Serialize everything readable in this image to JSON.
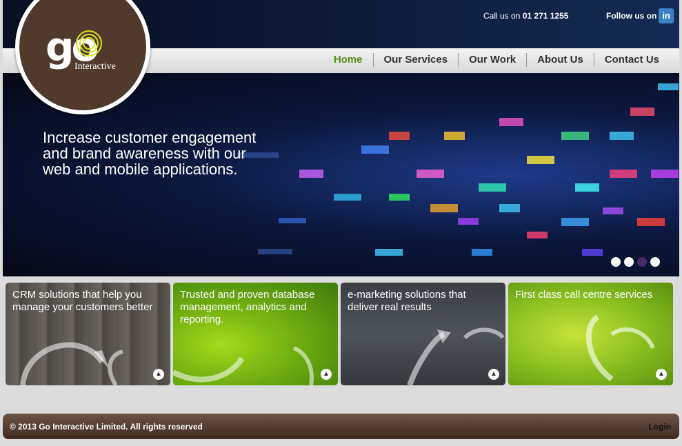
{
  "header": {
    "call_prefix": "Call us on",
    "phone": "01 271 1255",
    "follow_label": "Follow us on",
    "linkedin_glyph": "in"
  },
  "logo": {
    "wordmark": "go",
    "sub": "Interactive"
  },
  "nav": {
    "items": [
      "Home",
      "Our Services",
      "Our Work",
      "About Us",
      "Contact Us"
    ],
    "active": "Home"
  },
  "hero": {
    "headline": "Increase customer engagement and brand awareness with our web and mobile applications.",
    "slide_count": 4,
    "active_slide": 3
  },
  "tiles": [
    {
      "text": "CRM solutions that help you manage your customers better"
    },
    {
      "text": "Trusted and proven database management, analytics and reporting."
    },
    {
      "text": "e-marketing solutions that deliver real results"
    },
    {
      "text": "First class call centre services"
    }
  ],
  "footer": {
    "copyright": "© 2013 Go Interactive Limited. All rights reserved",
    "login": "Login"
  },
  "colors": {
    "brand_brown": "#4f3a2d",
    "nav_active": "#5a8f1a",
    "logo_accent": "#d8e81e"
  }
}
